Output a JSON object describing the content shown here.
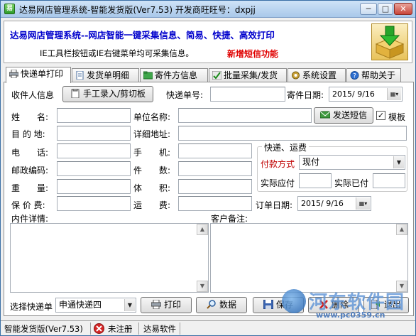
{
  "window": {
    "title": "达易网店管理系统-智能发货版(Ver7.53) 开发商旺旺号：dxpjj",
    "minimize": "─",
    "maximize": "□",
    "close": "✕"
  },
  "banner": {
    "title": "达易网店管理系统--网店智能一键采集信息、简易、快捷、高效打印",
    "subtitle": "IE工具栏按钮或IE右键菜单均可采集信息。",
    "new_feature": "新增短信功能"
  },
  "tabs": [
    {
      "label": "快递单打印",
      "icon": "printer-icon"
    },
    {
      "label": "发货单明细",
      "icon": "document-icon"
    },
    {
      "label": "寄件方信息",
      "icon": "folder-icon"
    },
    {
      "label": "批量采集/发货",
      "icon": "batch-icon"
    },
    {
      "label": "系统设置",
      "icon": "settings-icon"
    },
    {
      "label": "帮助关于",
      "icon": "help-icon"
    }
  ],
  "form": {
    "recipient_info": "收件人信息",
    "manual_input_button": "手工录入/剪切板",
    "tracking_number_label": "快递单号:",
    "tracking_number_value": "",
    "send_date_label": "寄件日期:",
    "send_date_value": "2015/ 9/16",
    "name_label": "姓　　名:",
    "company_label": "单位名称:",
    "send_sms_button": "发送短信",
    "template_label": "模板",
    "template_checked": true,
    "destination_label": "目 的 地:",
    "address_label": "详细地址:",
    "phone_label": "电　　话:",
    "mobile_label": "手　　机:",
    "postcode_label": "邮政编码:",
    "pieces_label": "件　　数:",
    "weight_label": "重　　量:",
    "volume_label": "体　　积:",
    "insurance_label": "保 价 费:",
    "freight_label": "运　　费:",
    "order_date_label": "订单日期:",
    "order_date_value": "2015/ 9/16",
    "contents_label": "内件详情:",
    "customer_note_label": "客户备注:",
    "express_group_title": "快递、运费",
    "payment_method_label": "付款方式",
    "payment_method_value": "现付",
    "actual_due_label": "实际应付",
    "actual_paid_label": "实际已付"
  },
  "bottom": {
    "select_express_label": "选择快递单",
    "select_express_value": "申通快递四",
    "print_button": "打印",
    "data_button": "数据",
    "save_button": "保存",
    "delete_button": "删除",
    "exit_button": "退出"
  },
  "status": {
    "version": "智能发货版(Ver7.53)",
    "registration": "未注册",
    "company": "达易软件"
  },
  "watermark": {
    "site_name": "河东软件园",
    "url": "www.pc0359.cn"
  },
  "colors": {
    "banner_title": "#0000cc",
    "new_feature": "#e00000",
    "payment_label": "#c00000"
  }
}
